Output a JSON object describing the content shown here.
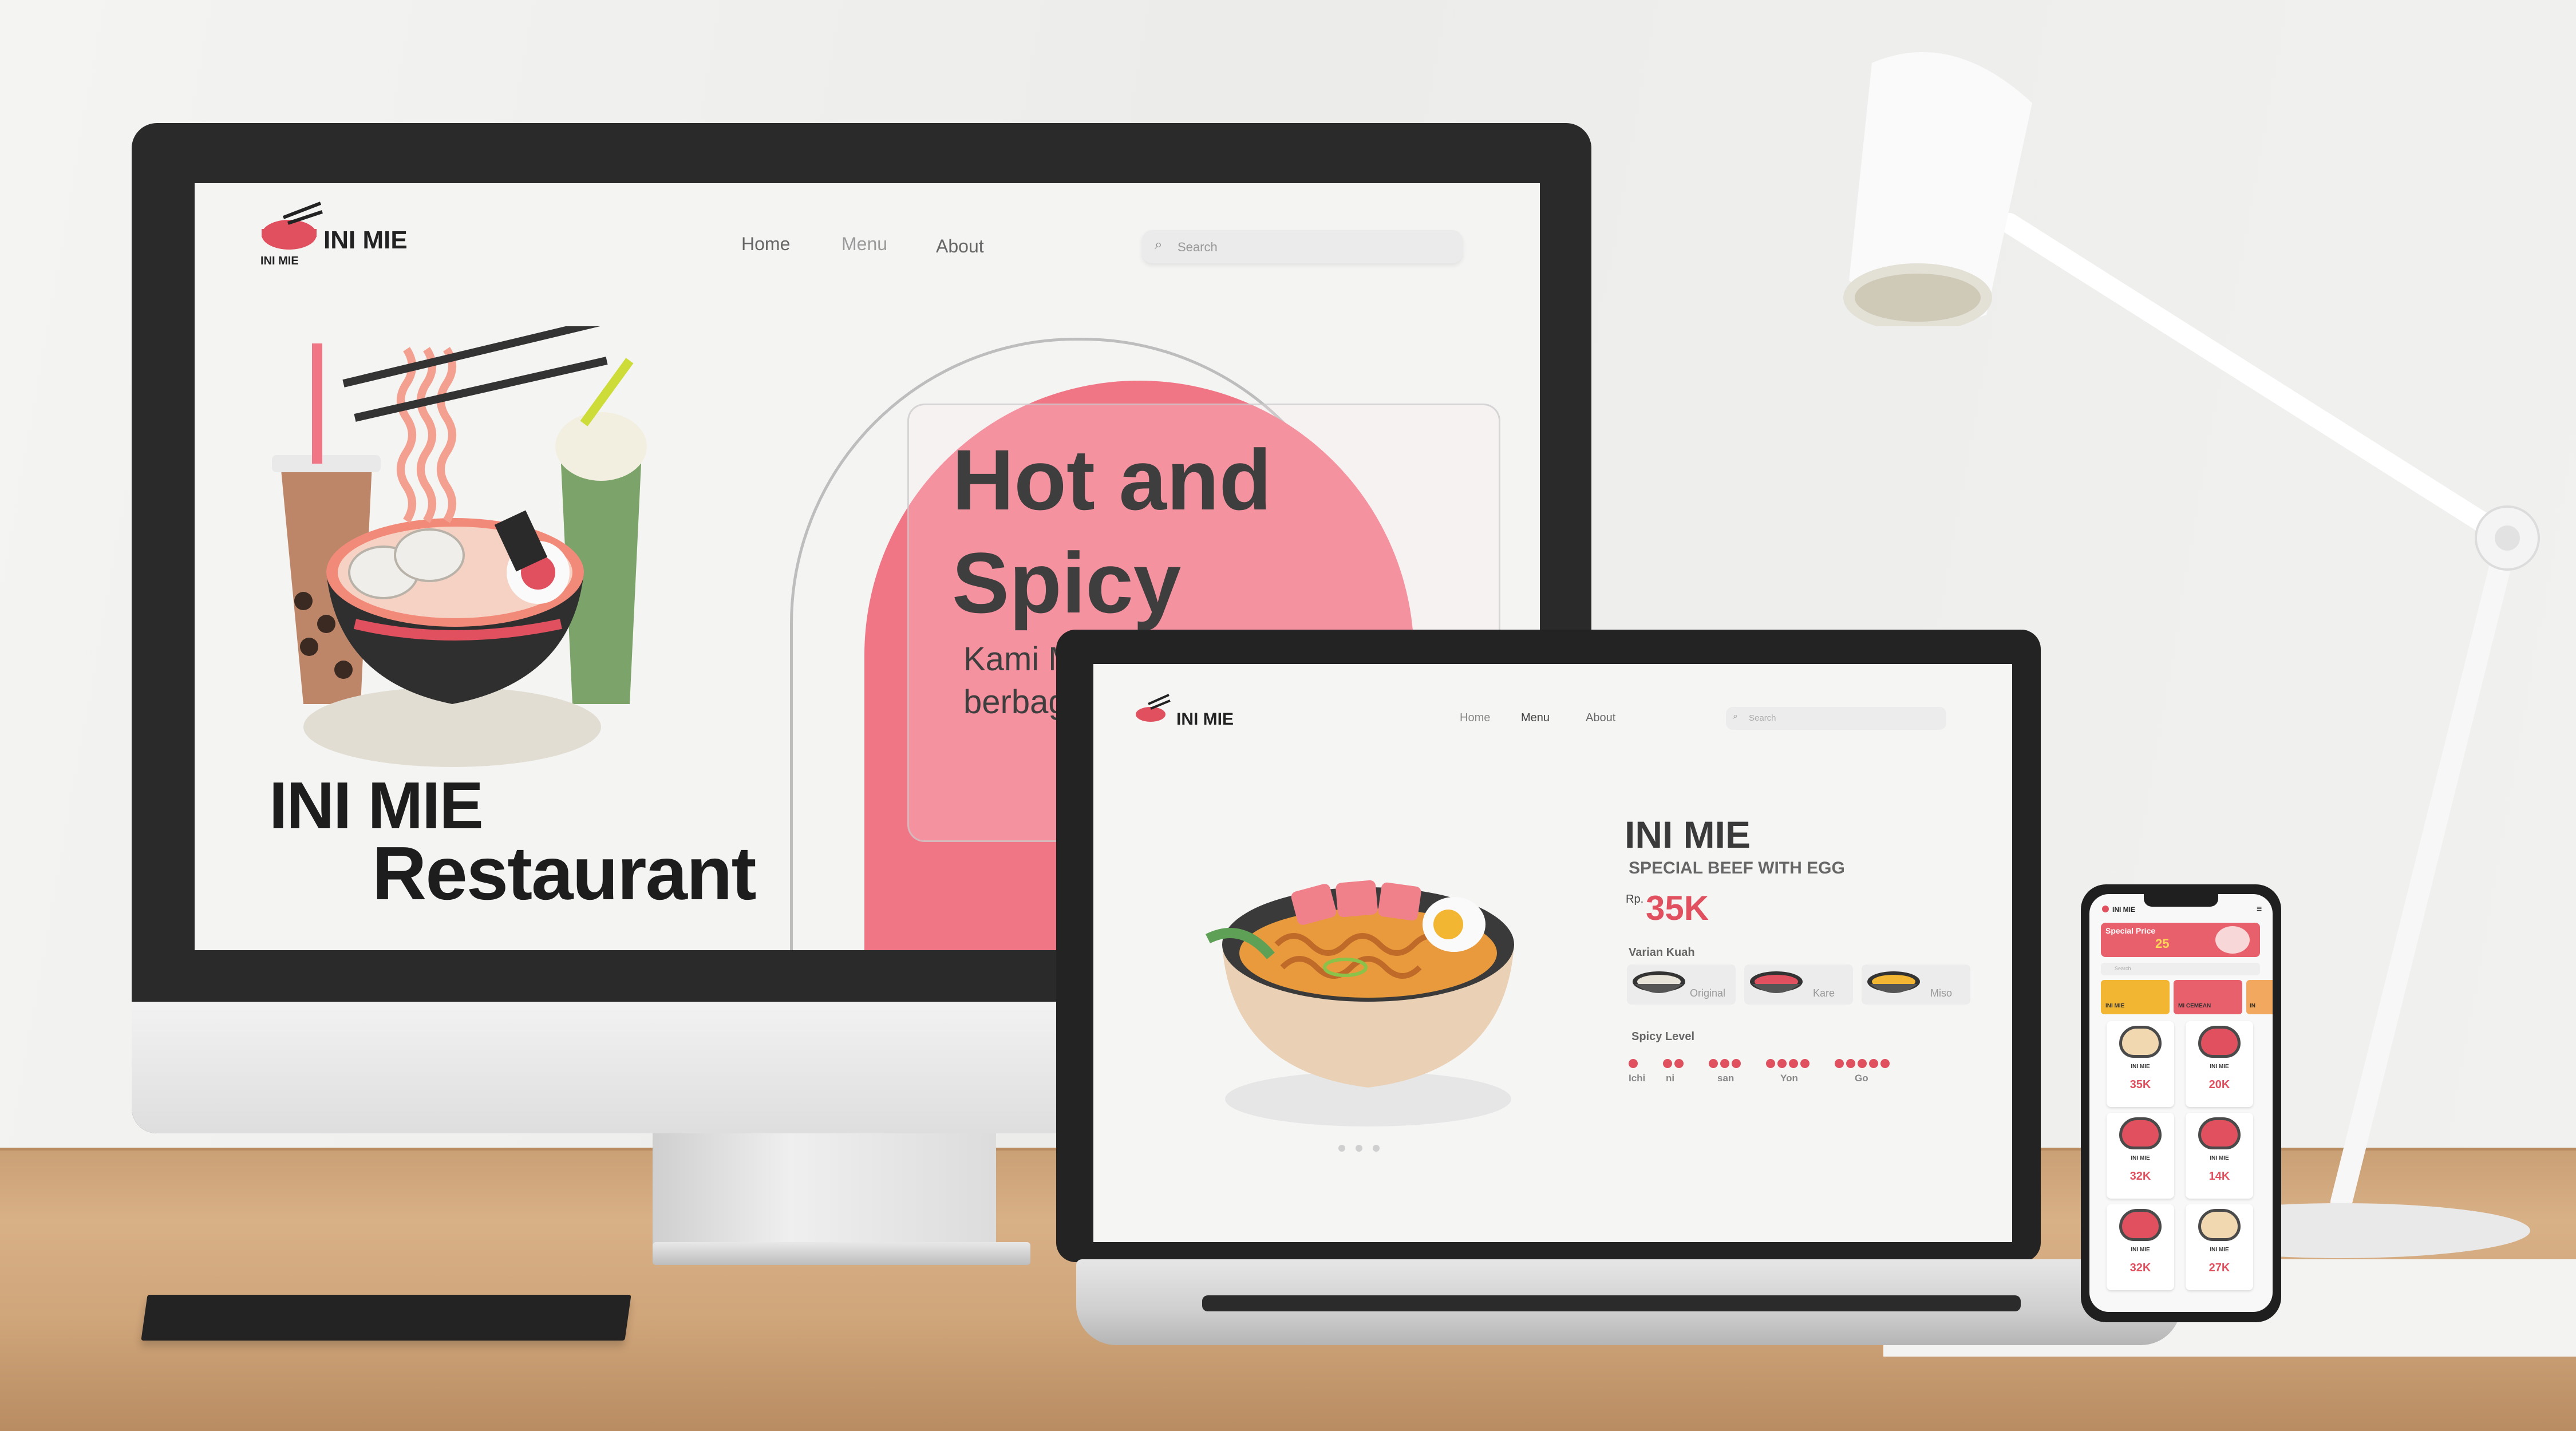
{
  "monitor_site": {
    "logo_text": "INI MIE",
    "logo_sub": "INI MIE",
    "brand": "INI MIE",
    "nav": [
      "Home",
      "Menu",
      "About"
    ],
    "search_placeholder": "Search",
    "hero_title_line1": "Hot and",
    "hero_title_line2": "Spicy",
    "hero_sub_line1": "Kami M",
    "hero_sub_line2": "berbag",
    "restaurant_line1": "INI MIE",
    "restaurant_line2": "Restaurant",
    "accent": "#f07585"
  },
  "laptop_site": {
    "logo_text": "INI MIE",
    "brand": "INI MIE",
    "nav": [
      "Home",
      "Menu",
      "About"
    ],
    "search_placeholder": "Search",
    "product_title": "INI MIE",
    "product_name": "SPECIAL BEEF WITH EGG",
    "currency": "Rp.",
    "price": "35K",
    "broth_label": "Varian Kuah",
    "broth_options": [
      "Original",
      "Kare",
      "Miso"
    ],
    "spicy_label": "Spicy Level",
    "spicy_levels": [
      {
        "name": "Ichi",
        "dots": 1
      },
      {
        "name": "ni",
        "dots": 2
      },
      {
        "name": "san",
        "dots": 3
      },
      {
        "name": "Yon",
        "dots": 4
      },
      {
        "name": "Go",
        "dots": 5
      }
    ],
    "carousel_dots": 3,
    "accent": "#e0505e"
  },
  "phone_site": {
    "brand": "INI MIE",
    "banner_title": "Special Price",
    "banner_value": "25",
    "search_placeholder": "Search",
    "categories": [
      "INI MIE",
      "MI CEMEAN",
      "IN"
    ],
    "items": [
      {
        "title": "INI MIE",
        "price": "35K"
      },
      {
        "title": "INI MIE",
        "price": "20K"
      },
      {
        "title": "INI MIE",
        "price": "32K"
      },
      {
        "title": "INI MIE",
        "price": "14K"
      },
      {
        "title": "INI MIE",
        "price": "32K"
      },
      {
        "title": "INI MIE",
        "price": "27K"
      }
    ],
    "accent": "#e0505e"
  }
}
